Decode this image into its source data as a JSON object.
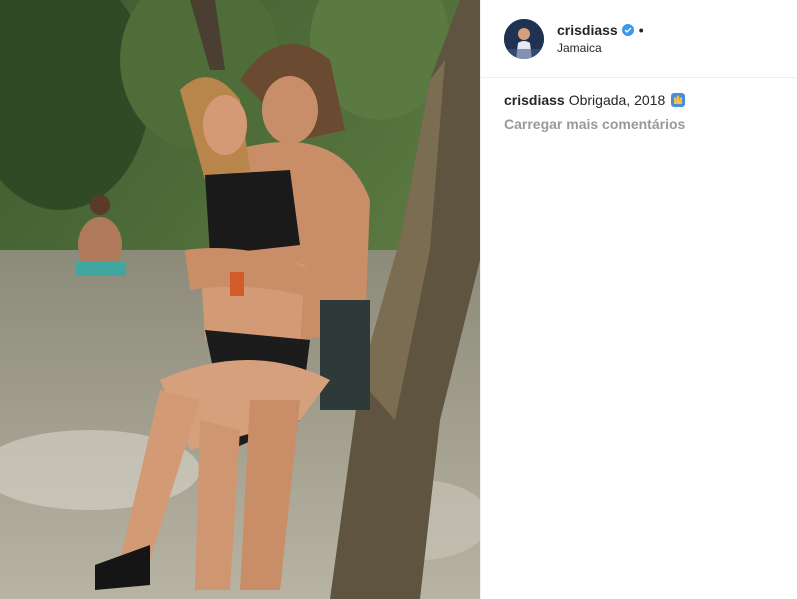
{
  "post": {
    "username": "crisdiass",
    "location": "Jamaica",
    "separator": "•",
    "caption_user": "crisdiass",
    "caption_text": "Obrigada, 2018",
    "load_more": "Carregar mais comentários"
  },
  "icons": {
    "verified": "verified-badge-icon",
    "emoji": "raised-hands-emoji-icon"
  },
  "colors": {
    "verified": "#3897f0",
    "muted_text": "#999999",
    "border": "#efefef"
  }
}
